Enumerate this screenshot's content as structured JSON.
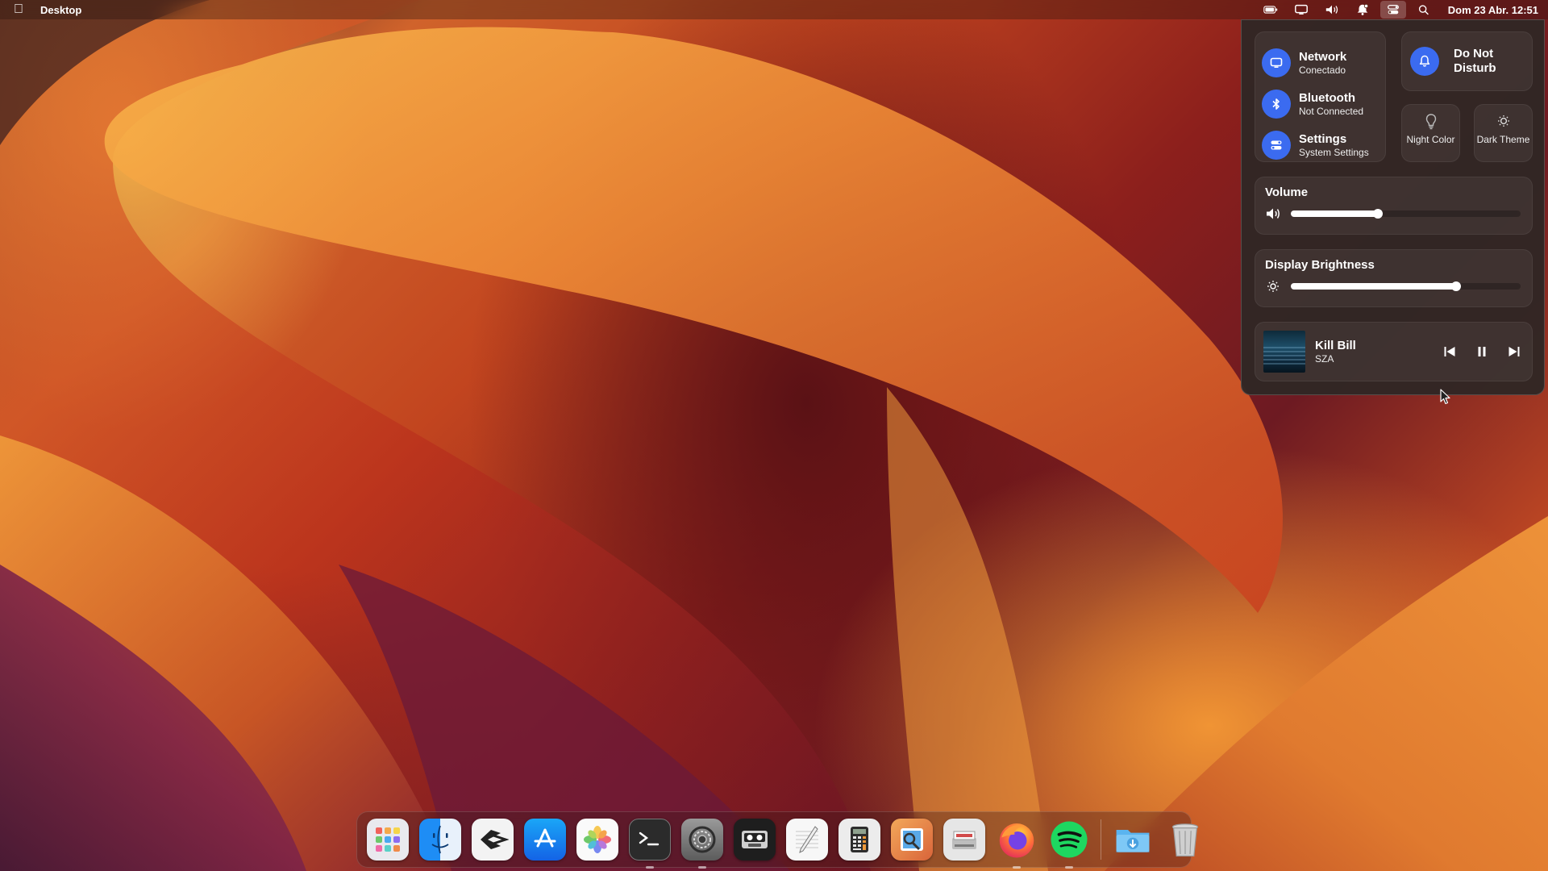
{
  "menubar": {
    "apple_icon": "apple-logo-icon",
    "app_name": "Desktop",
    "status_icons": [
      "battery-icon",
      "display-icon",
      "volume-icon",
      "notification-bell-icon",
      "control-center-icon",
      "search-icon"
    ],
    "clock": "Dom 23 Abr. 12:51"
  },
  "control_center": {
    "network": {
      "title": "Network",
      "subtitle": "Conectado",
      "icon": "monitor-icon"
    },
    "bluetooth": {
      "title": "Bluetooth",
      "subtitle": "Not Connected",
      "icon": "bluetooth-icon"
    },
    "settings": {
      "title": "Settings",
      "subtitle": "System Settings",
      "icon": "toggles-icon"
    },
    "dnd": {
      "title": "Do Not Disturb",
      "icon": "bell-icon"
    },
    "night_color": {
      "label": "Night Color",
      "icon": "lightbulb-icon"
    },
    "dark_theme": {
      "label": "Dark Theme",
      "icon": "sun-icon"
    },
    "volume": {
      "title": "Volume",
      "level": 0.38,
      "icon": "speaker-icon"
    },
    "brightness": {
      "title": "Display Brightness",
      "level": 0.72,
      "icon": "brightness-icon"
    },
    "media": {
      "title": "Kill Bill",
      "artist": "SZA"
    },
    "accent": "#3b6bf0"
  },
  "dock": {
    "apps": [
      {
        "name": "launchpad",
        "running": false
      },
      {
        "name": "finder",
        "running": false
      },
      {
        "name": "code-editor",
        "running": false
      },
      {
        "name": "app-store",
        "running": false
      },
      {
        "name": "photos",
        "running": false
      },
      {
        "name": "terminal",
        "running": true
      },
      {
        "name": "system-settings",
        "running": true
      },
      {
        "name": "cassette-player",
        "running": false
      },
      {
        "name": "text-editor",
        "running": false
      },
      {
        "name": "calculator",
        "running": false
      },
      {
        "name": "image-viewer",
        "running": false
      },
      {
        "name": "scanner",
        "running": false
      },
      {
        "name": "firefox",
        "running": true
      },
      {
        "name": "spotify",
        "running": true
      }
    ],
    "extras": [
      "downloads-folder",
      "trash"
    ]
  }
}
